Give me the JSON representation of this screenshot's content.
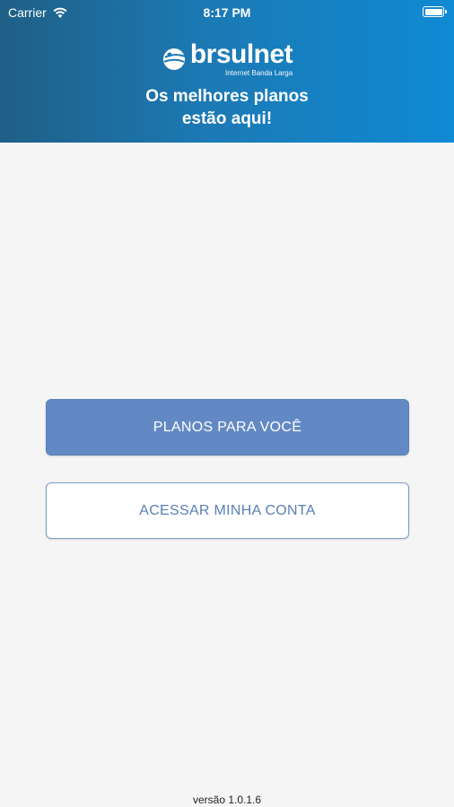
{
  "status_bar": {
    "carrier": "Carrier",
    "time": "8:17 PM"
  },
  "logo": {
    "name": "brsulnet",
    "tagline": "Internet Banda Larga"
  },
  "headline": {
    "line1": "Os melhores planos",
    "line2": "estão aqui!"
  },
  "buttons": {
    "plans_label": "PLANOS PARA VOCÊ",
    "account_label": "ACESSAR MINHA CONTA"
  },
  "footer": {
    "version": "versão 1.0.1.6"
  },
  "colors": {
    "header_start": "#1f5f86",
    "header_end": "#0f8ad4",
    "primary_button": "#6389c4",
    "secondary_text": "#5a7fb6",
    "background": "#f5f5f5"
  },
  "icons": {
    "wifi": "wifi-icon",
    "battery": "battery-icon",
    "logo_mark": "globe-logo-icon"
  }
}
